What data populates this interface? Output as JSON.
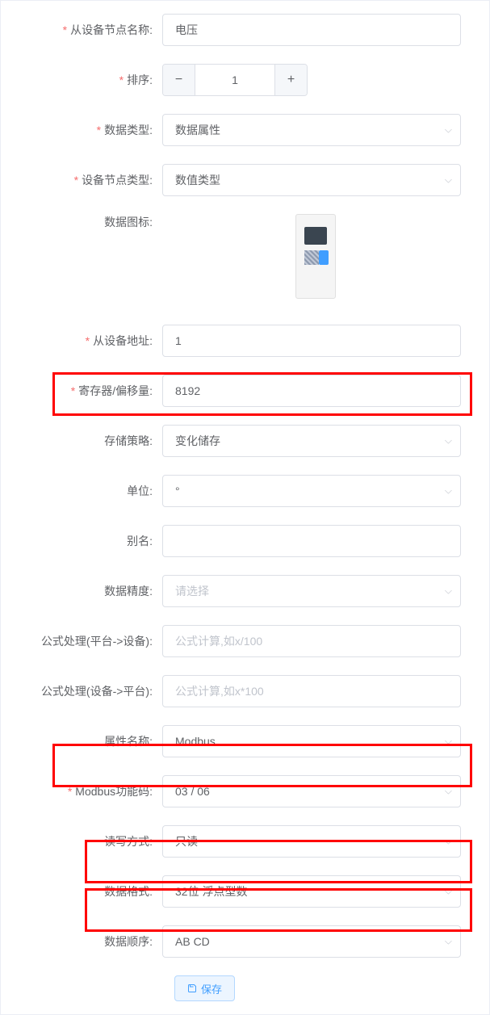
{
  "labels": {
    "node_name": "从设备节点名称:",
    "sort": "排序:",
    "data_type": "数据类型:",
    "node_type": "设备节点类型:",
    "data_icon": "数据图标:",
    "device_addr": "从设备地址:",
    "register": "寄存器/偏移量:",
    "storage": "存储策略:",
    "unit": "单位:",
    "alias": "别名:",
    "precision": "数据精度:",
    "formula_p2d": "公式处理(平台->设备):",
    "formula_d2p": "公式处理(设备->平台):",
    "attr_name": "属性名称:",
    "func_code": "Modbus功能码:",
    "rw_mode": "读写方式:",
    "data_format": "数据格式:",
    "data_order": "数据顺序:"
  },
  "values": {
    "node_name": "电压",
    "sort": "1",
    "data_type": "数据属性",
    "node_type": "数值类型",
    "device_addr": "1",
    "register": "8192",
    "storage": "变化储存",
    "unit": "°",
    "alias": "",
    "precision": "",
    "formula_p2d": "",
    "formula_d2p": "",
    "attr_name": "Modbus",
    "func_code": "03 / 06",
    "rw_mode": "只读",
    "data_format": "32位 浮点型数",
    "data_order": "AB CD"
  },
  "placeholders": {
    "precision": "请选择",
    "formula_p2d": "公式计算,如x/100",
    "formula_d2p": "公式计算,如x*100"
  },
  "buttons": {
    "save": "保存"
  }
}
